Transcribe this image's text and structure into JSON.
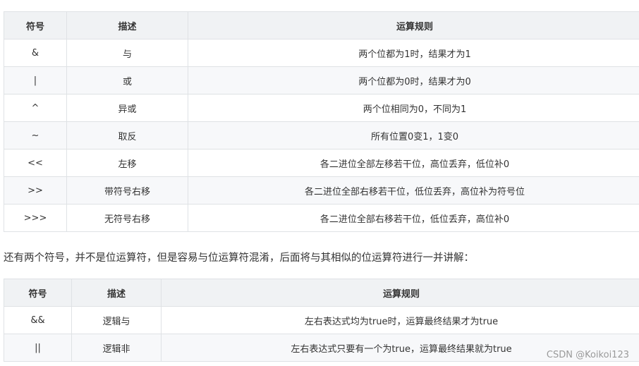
{
  "table1": {
    "headers": [
      "符号",
      "描述",
      "运算规则"
    ],
    "rows": [
      [
        "&",
        "与",
        "两个位都为1时，结果才为1"
      ],
      [
        "|",
        "或",
        "两个位都为0时，结果才为0"
      ],
      [
        "^",
        "异或",
        "两个位相同为0，不同为1"
      ],
      [
        "~",
        "取反",
        "所有位置0变1，1变0"
      ],
      [
        "<<",
        "左移",
        "各二进位全部左移若干位，高位丢弃，低位补0"
      ],
      [
        ">>",
        "带符号右移",
        "各二进位全部右移若干位，低位丢弃，高位补为符号位"
      ],
      [
        ">>>",
        "无符号右移",
        "各二进位全部右移若干位，低位丢弃，高位补0"
      ]
    ]
  },
  "paragraph": "还有两个符号，并不是位运算符，但是容易与位运算符混淆，后面将与其相似的位运算符进行一并讲解：",
  "table2": {
    "headers": [
      "符号",
      "描述",
      "运算规则"
    ],
    "rows": [
      [
        "&&",
        "逻辑与",
        "左右表达式均为true时，运算最终结果才为true"
      ],
      [
        "||",
        "逻辑非",
        "左右表达式只要有一个为true，运算最终结果就为true"
      ]
    ]
  },
  "watermark": "CSDN @Koikoi123"
}
